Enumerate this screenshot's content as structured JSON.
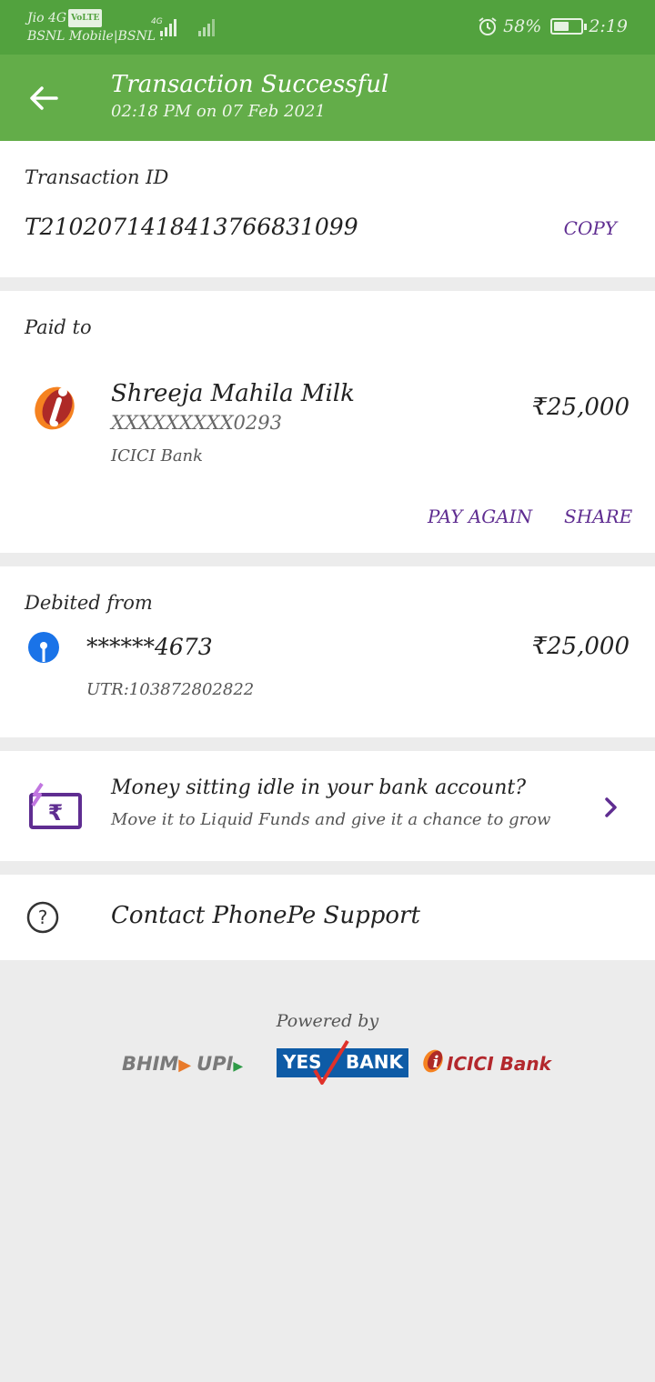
{
  "status_bar": {
    "carrier_line1": "Jio 4G",
    "volte": "VoLTE",
    "carrier_line2": "BSNL Mobile|BSNL .",
    "network_type": "4G",
    "battery_percent": "58%",
    "battery_level": 0.58,
    "time": "2:19"
  },
  "header": {
    "title": "Transaction Successful",
    "subtitle": "02:18 PM on 07 Feb 2021"
  },
  "transaction": {
    "label": "Transaction ID",
    "id": "T2102071418413766831099",
    "copy_label": "COPY"
  },
  "paid_to": {
    "label": "Paid to",
    "name": "Shreeja Mahila Milk",
    "account": "XXXXXXXXX0293",
    "bank": "ICICI Bank",
    "amount": "₹25,000",
    "pay_again_label": "PAY AGAIN",
    "share_label": "SHARE"
  },
  "debited_from": {
    "label": "Debited from",
    "account": "******4673",
    "utr": "UTR:103872802822",
    "amount": "₹25,000"
  },
  "promo": {
    "title": "Money sitting idle in your bank account?",
    "subtitle": "Move it to Liquid Funds and give it a chance to grow",
    "icon_glyph": "₹"
  },
  "support": {
    "label": "Contact PhonePe Support",
    "icon_glyph": "?"
  },
  "footer": {
    "powered_by": "Powered by",
    "logo_bhim": "BHIM",
    "logo_upi": "UPI",
    "logo_yes": "YES",
    "logo_bank": "BANK",
    "logo_icici": "ICICI Bank",
    "logo_icici_glyph": "i"
  },
  "colors": {
    "status_bar": "#52a23e",
    "app_bar": "#63ad49",
    "accent_purple": "#5f2d91",
    "background": "#ececec"
  }
}
